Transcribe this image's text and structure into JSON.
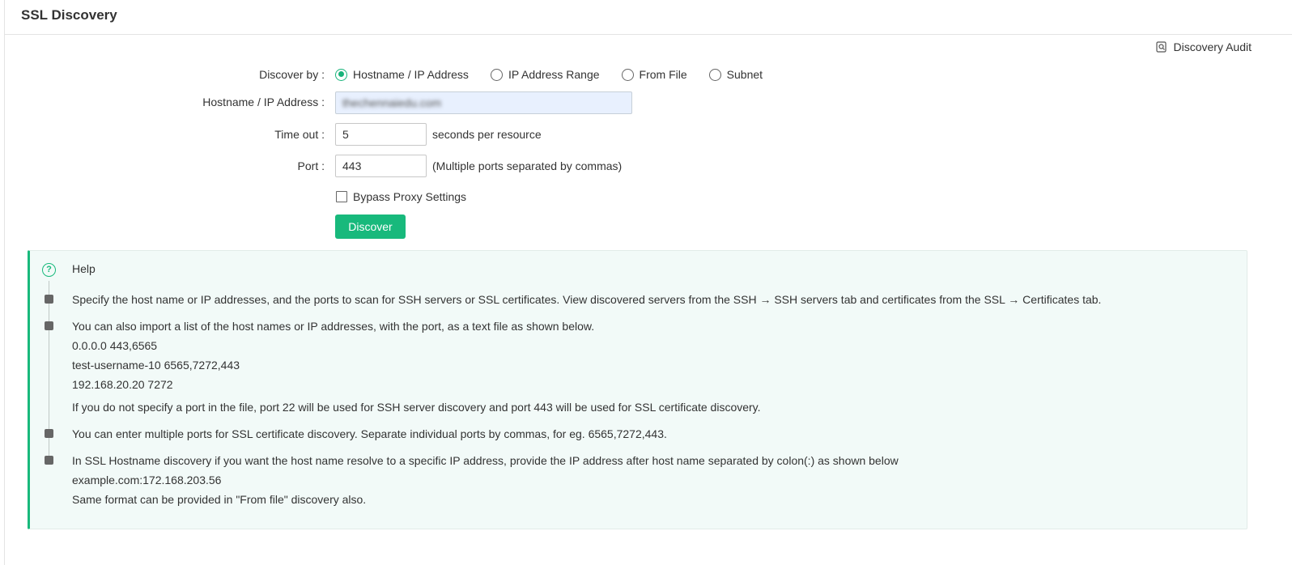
{
  "header": {
    "title": "SSL Discovery"
  },
  "audit": {
    "label": "Discovery Audit",
    "icon": "audit-search-icon"
  },
  "form": {
    "discover_by_label": "Discover by :",
    "radio_options": [
      {
        "label": "Hostname / IP Address",
        "checked": true
      },
      {
        "label": "IP Address Range",
        "checked": false
      },
      {
        "label": "From File",
        "checked": false
      },
      {
        "label": "Subnet",
        "checked": false
      }
    ],
    "hostname_label": "Hostname / IP Address :",
    "hostname_value": "thechennaiedu.com",
    "timeout_label": "Time out :",
    "timeout_value": "5",
    "timeout_note": "seconds per resource",
    "port_label": "Port :",
    "port_value": "443",
    "port_note": "(Multiple ports separated by commas)",
    "bypass_label": "Bypass Proxy Settings",
    "bypass_checked": false,
    "discover_button": "Discover"
  },
  "help": {
    "title": "Help",
    "items": [
      {
        "lines": [
          "Specify the host name or IP addresses, and the ports to scan for SSH servers or SSL certificates. View discovered servers from the SSH → SSH servers tab and certificates from the SSL → Certificates tab."
        ]
      },
      {
        "lines": [
          "You can also import a list of the host names or IP addresses, with the port, as a text file as shown below.",
          "0.0.0.0 443,6565",
          "test-username-10 6565,7272,443",
          "192.168.20.20 7272",
          "If you do not specify a port in the file, port 22 will be used for SSH server discovery and port 443 will be used for SSL certificate discovery."
        ]
      },
      {
        "lines": [
          "You can enter multiple ports for SSL certificate discovery. Separate individual ports by commas, for eg. 6565,7272,443."
        ]
      },
      {
        "lines": [
          "In SSL Hostname discovery if you want the host name resolve to a specific IP address, provide the IP address after host name separated by colon(:) as shown below",
          "example.com:172.168.203.56",
          "Same format can be provided in \"From file\" discovery also."
        ]
      }
    ]
  },
  "colors": {
    "accent": "#18b97c",
    "help_bg": "#f2faf8"
  }
}
